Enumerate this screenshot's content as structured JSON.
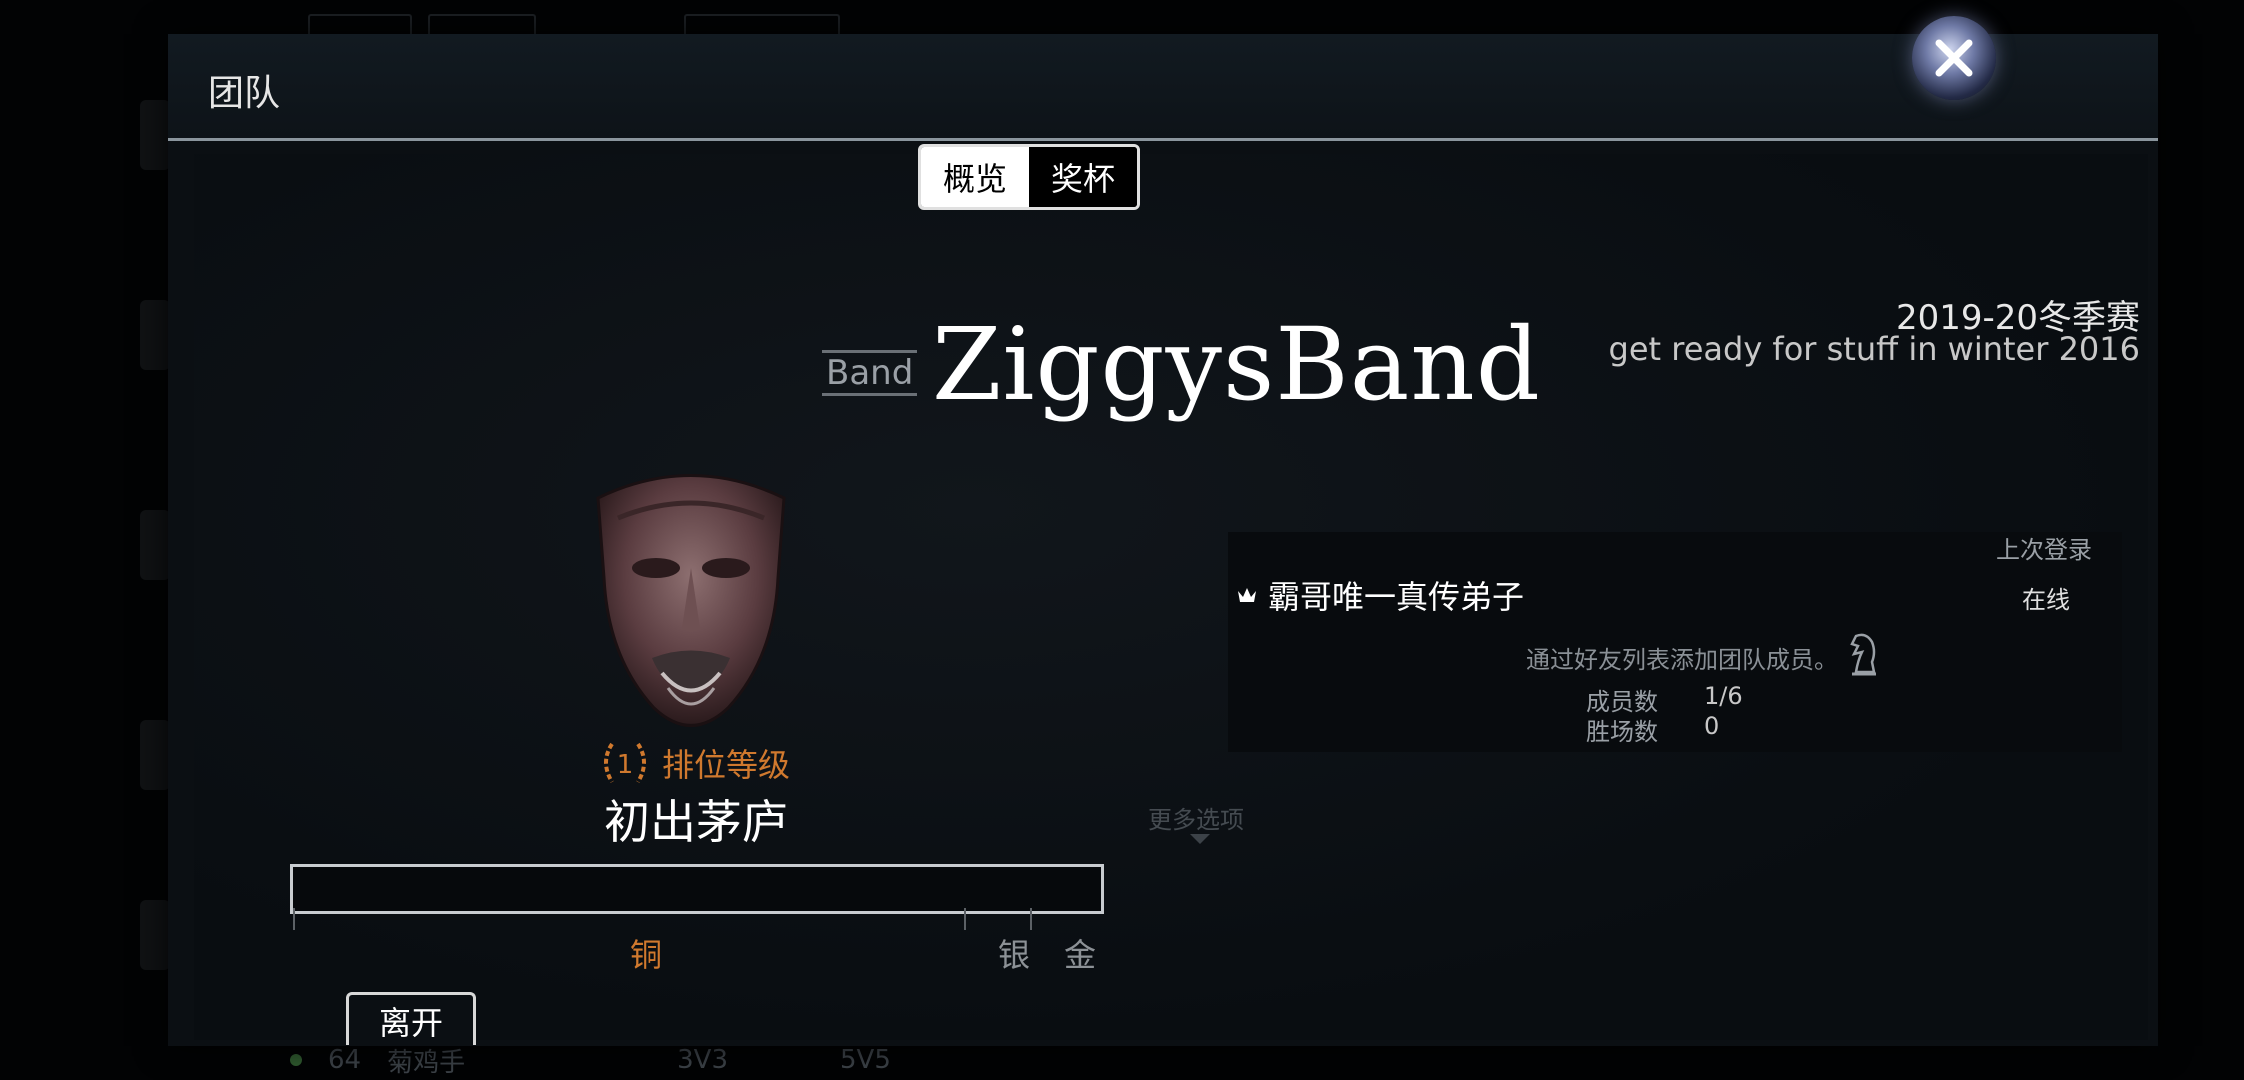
{
  "modal": {
    "title": "团队"
  },
  "tabs": [
    {
      "label": "概览",
      "active": true
    },
    {
      "label": "奖杯",
      "active": false
    }
  ],
  "team": {
    "prefix": "Band",
    "name": "ZiggysBand"
  },
  "season": {
    "title": "2019-20冬季赛",
    "subtitle": "get ready for stuff in winter 2016"
  },
  "rank": {
    "number": "1",
    "label": "排位等级",
    "name": "初出茅庐",
    "progress": 0
  },
  "tiers": {
    "bronze": "铜",
    "silver": "银",
    "gold": "金"
  },
  "actions": {
    "leave": "离开",
    "more_options": "更多选项"
  },
  "members": {
    "last_login_header": "上次登录",
    "list": [
      {
        "name": "霸哥唯一真传弟子",
        "status": "在线",
        "is_leader": true
      }
    ],
    "add_hint": "通过好友列表添加团队成员。"
  },
  "stats": {
    "members_label": "成员数",
    "members_value": "1/6",
    "wins_label": "胜场数",
    "wins_value": "0"
  },
  "background": {
    "level": "64",
    "player": "菊鸡手",
    "mode_3v3": "3V3",
    "mode_5v5": "5V5"
  },
  "colors": {
    "accent_bronze": "#d0792e",
    "tab_active_bg": "#ffffff",
    "panel_bg": "#0b0f13"
  }
}
